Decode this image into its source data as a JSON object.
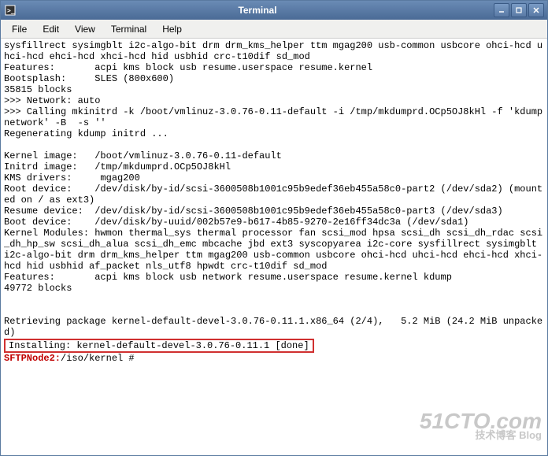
{
  "window": {
    "title": "Terminal"
  },
  "menu": {
    "file": "File",
    "edit": "Edit",
    "view": "View",
    "terminal": "Terminal",
    "help": "Help"
  },
  "terminal": {
    "line1": "sysfillrect sysimgblt i2c-algo-bit drm drm_kms_helper ttm mgag200 usb-common usbcore ohci-hcd uhci-hcd ehci-hcd xhci-hcd hid usbhid crc-t10dif sd_mod",
    "line2": "Features:       acpi kms block usb resume.userspace resume.kernel",
    "line3": "Bootsplash:     SLES (800x600)",
    "line4": "35815 blocks",
    "line5": ">>> Network: auto",
    "line6": ">>> Calling mkinitrd -k /boot/vmlinuz-3.0.76-0.11-default -i /tmp/mkdumprd.OCp5OJ8kHl -f 'kdump network' -B  -s ''",
    "line7": "Regenerating kdump initrd ...",
    "line8": "",
    "line9": "Kernel image:   /boot/vmlinuz-3.0.76-0.11-default",
    "line10": "Initrd image:   /tmp/mkdumprd.OCp5OJ8kHl",
    "line11": "KMS drivers:     mgag200",
    "line12": "Root device:    /dev/disk/by-id/scsi-3600508b1001c95b9edef36eb455a58c0-part2 (/dev/sda2) (mounted on / as ext3)",
    "line13": "Resume device:  /dev/disk/by-id/scsi-3600508b1001c95b9edef36eb455a58c0-part3 (/dev/sda3)",
    "line14": "Boot device:    /dev/disk/by-uuid/002b57e9-b617-4b85-9270-2e16ff34dc3a (/dev/sda1)",
    "line15": "Kernel Modules: hwmon thermal_sys thermal processor fan scsi_mod hpsa scsi_dh scsi_dh_rdac scsi_dh_hp_sw scsi_dh_alua scsi_dh_emc mbcache jbd ext3 syscopyarea i2c-core sysfillrect sysimgblt i2c-algo-bit drm drm_kms_helper ttm mgag200 usb-common usbcore ohci-hcd uhci-hcd ehci-hcd xhci-hcd hid usbhid af_packet nls_utf8 hpwdt crc-t10dif sd_mod",
    "line16": "Features:       acpi kms block usb network resume.userspace resume.kernel kdump",
    "line17": "49772 blocks",
    "line18": "",
    "line19": "",
    "line20": "Retrieving package kernel-default-devel-3.0.76-0.11.1.x86_64 (2/4),   5.2 MiB (24.2 MiB unpacked)",
    "highlighted": "Installing: kernel-default-devel-3.0.76-0.11.1 [done]",
    "prompt_host": "SFTPNode2:",
    "prompt_path": "/iso/kernel #"
  },
  "watermark": {
    "main": "51CTO.com",
    "sub": "技术博客   Blog"
  }
}
